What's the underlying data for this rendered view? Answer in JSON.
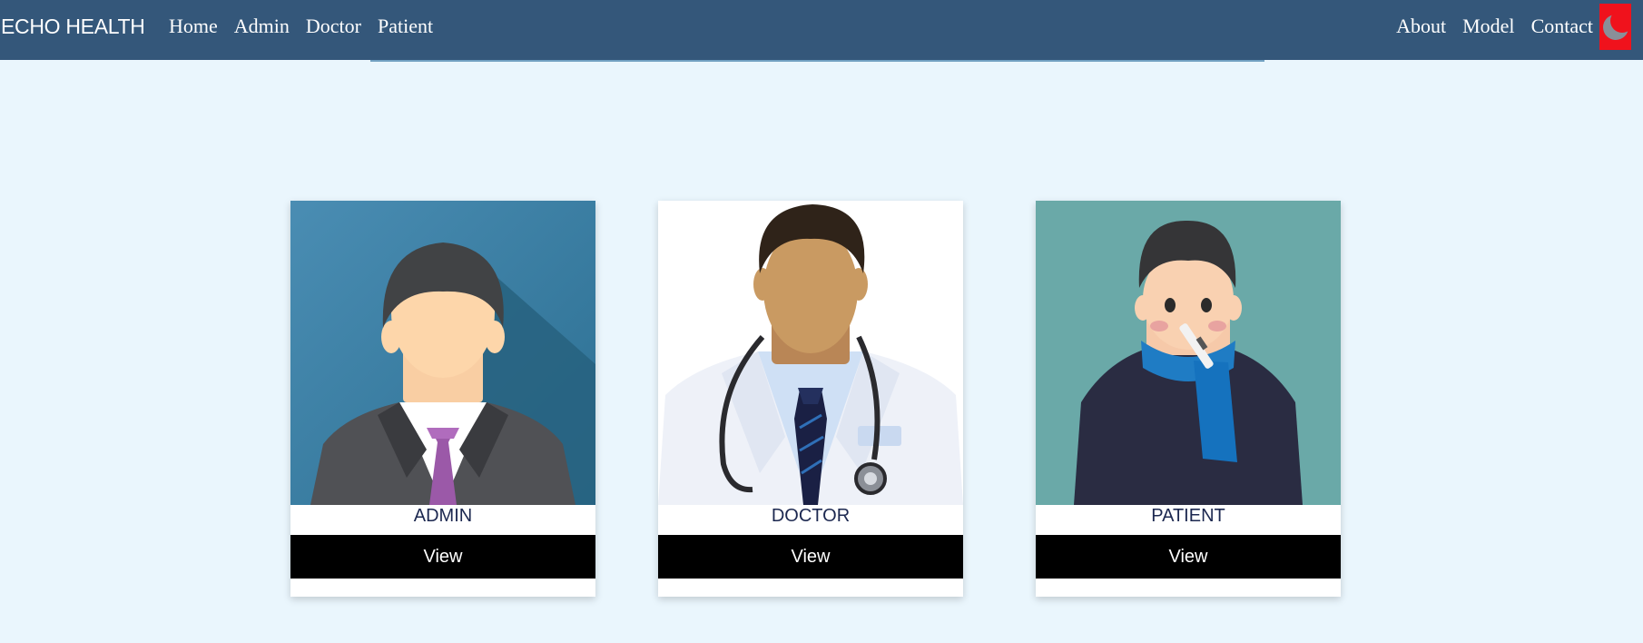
{
  "navbar": {
    "brand": "ECHO HEALTH",
    "left_links": [
      "Home",
      "Admin",
      "Doctor",
      "Patient"
    ],
    "right_links": [
      "About",
      "Model",
      "Contact"
    ],
    "logout_icon": "moon-icon",
    "bg_color": "#34577a",
    "logout_color": "#f0121c"
  },
  "cards": [
    {
      "title": "ADMIN",
      "button": "View",
      "image": "admin-avatar"
    },
    {
      "title": "DOCTOR",
      "button": "View",
      "image": "doctor-avatar"
    },
    {
      "title": "PATIENT",
      "button": "View",
      "image": "patient-avatar"
    }
  ],
  "colors": {
    "page_bg": "#eaf6fd",
    "button_bg": "#000000"
  }
}
